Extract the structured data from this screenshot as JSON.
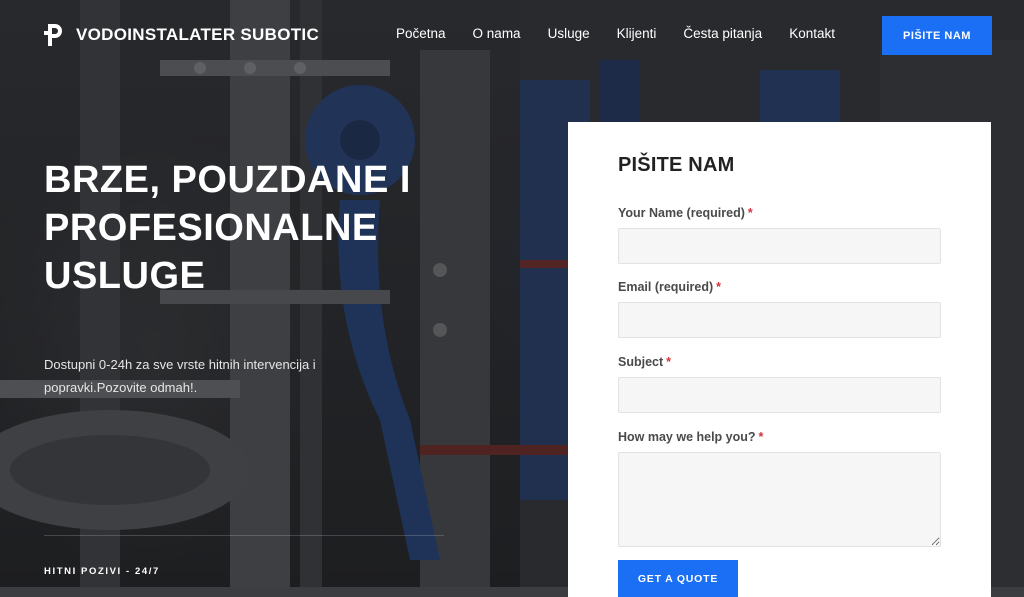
{
  "brand": {
    "name": "VODOINSTALATER SUBOTIC",
    "logo_icon": "p-letter-logo-icon"
  },
  "nav": {
    "items": [
      {
        "label": "Početna"
      },
      {
        "label": "O nama"
      },
      {
        "label": "Usluge"
      },
      {
        "label": "Klijenti"
      },
      {
        "label": "Česta pitanja"
      },
      {
        "label": "Kontakt"
      }
    ],
    "cta_label": "PIŠITE NAM"
  },
  "hero": {
    "title_line1": "BRZE, POUZDANE I",
    "title_line2": "PROFESIONALNE",
    "title_line3": "USLUGE",
    "subtitle": "Dostupni 0-24h za sve vrste hitnih intervencija i popravki.Pozovite odmah!.",
    "hotline_label": "HITNI POZIVI - 24/7"
  },
  "form": {
    "title": "PIŠITE NAM",
    "fields": [
      {
        "label": "Your Name (required)",
        "required_mark": "*",
        "value": "",
        "placeholder": ""
      },
      {
        "label": "Email (required)",
        "required_mark": "*",
        "value": "",
        "placeholder": ""
      },
      {
        "label": "Subject",
        "required_mark": "*",
        "value": "",
        "placeholder": ""
      },
      {
        "label": "How may we help you?",
        "required_mark": "*",
        "value": "",
        "placeholder": ""
      }
    ],
    "submit_label": "GET A QUOTE"
  },
  "colors": {
    "accent": "#1a6ff5",
    "required": "#d0343a",
    "card_bg": "#ffffff",
    "overlay": "#1a1b1c"
  }
}
